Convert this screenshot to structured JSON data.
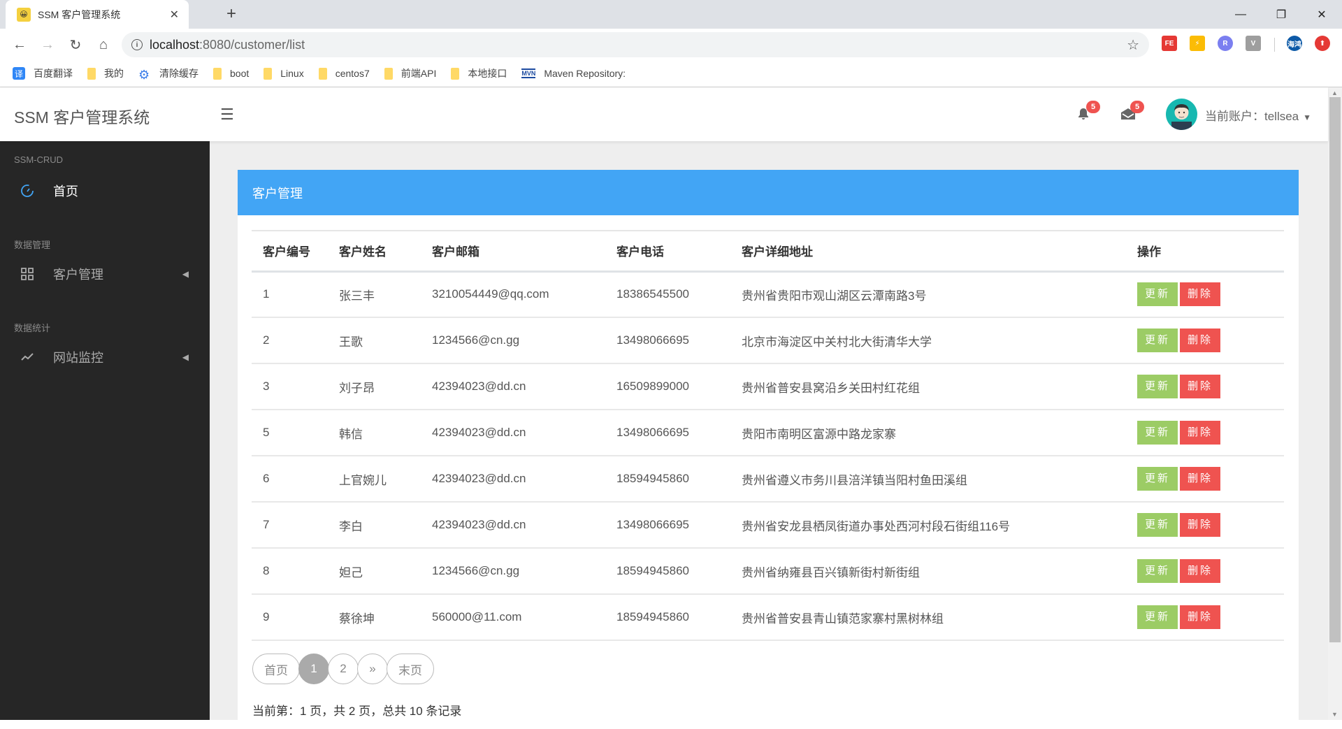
{
  "browser": {
    "tab_title": "SSM 客户管理系统",
    "url_host": "localhost",
    "url_path": ":8080/customer/list",
    "extensions": [
      {
        "name": "fe-helper",
        "label": "FE",
        "color": "#e53935"
      },
      {
        "name": "lightning-ext",
        "label": "⚡",
        "color": "#fbbc05"
      },
      {
        "name": "r-ext",
        "label": "R",
        "color": "#7b7ff0"
      },
      {
        "name": "vue-devtools",
        "label": "V",
        "color": "#9e9e9e"
      },
      {
        "name": "haihong-ext",
        "label": "海鸿",
        "color": "#0d5aa7"
      },
      {
        "name": "upload-ext",
        "label": "⬆",
        "color": "#e53935"
      }
    ],
    "bookmarks": [
      {
        "label": "百度翻译",
        "icon": "translate-icon"
      },
      {
        "label": "我的",
        "icon": "folder-icon"
      },
      {
        "label": "清除缓存",
        "icon": "gear-icon"
      },
      {
        "label": "boot",
        "icon": "folder-icon"
      },
      {
        "label": "Linux",
        "icon": "folder-icon"
      },
      {
        "label": "centos7",
        "icon": "folder-icon"
      },
      {
        "label": "前端API",
        "icon": "folder-icon"
      },
      {
        "label": "本地接口",
        "icon": "folder-icon"
      },
      {
        "label": "Maven Repository:",
        "icon": "mvn-icon"
      }
    ]
  },
  "header": {
    "brand": "SSM 客户管理系统",
    "notifications_count": "5",
    "messages_count": "5",
    "account_label": "当前账户：tellsea"
  },
  "sidebar": {
    "sections": [
      {
        "title": "SSM-CRUD",
        "items": [
          {
            "label": "首页",
            "icon": "dashboard-icon",
            "active": true
          }
        ]
      },
      {
        "title": "数据管理",
        "items": [
          {
            "label": "客户管理",
            "icon": "grid-icon",
            "active": false
          }
        ]
      },
      {
        "title": "数据统计",
        "items": [
          {
            "label": "网站监控",
            "icon": "line-chart-icon",
            "active": false
          }
        ]
      }
    ]
  },
  "panel": {
    "title": "客户管理",
    "columns": [
      "客户编号",
      "客户姓名",
      "客户邮箱",
      "客户电话",
      "客户详细地址",
      "操作"
    ],
    "update_label": "更新",
    "delete_label": "删除",
    "rows": [
      {
        "id": "1",
        "name": "张三丰",
        "email": "3210054449@qq.com",
        "phone": "18386545500",
        "address": "贵州省贵阳市观山湖区云潭南路3号"
      },
      {
        "id": "2",
        "name": "王歌",
        "email": "1234566@cn.gg",
        "phone": "13498066695",
        "address": "北京市海淀区中关村北大街清华大学"
      },
      {
        "id": "3",
        "name": "刘子昂",
        "email": "42394023@dd.cn",
        "phone": "16509899000",
        "address": "贵州省普安县窝沿乡关田村红花组"
      },
      {
        "id": "5",
        "name": "韩信",
        "email": "42394023@dd.cn",
        "phone": "13498066695",
        "address": "贵阳市南明区富源中路龙家寨"
      },
      {
        "id": "6",
        "name": "上官婉儿",
        "email": "42394023@dd.cn",
        "phone": "18594945860",
        "address": "贵州省遵义市务川县涪洋镇当阳村鱼田溪组"
      },
      {
        "id": "7",
        "name": "李白",
        "email": "42394023@dd.cn",
        "phone": "13498066695",
        "address": "贵州省安龙县栖凤街道办事处西河村段石街组116号"
      },
      {
        "id": "8",
        "name": "妲己",
        "email": "1234566@cn.gg",
        "phone": "18594945860",
        "address": "贵州省纳雍县百兴镇新街村新街组"
      },
      {
        "id": "9",
        "name": "蔡徐坤",
        "email": "560000@11.com",
        "phone": "18594945860",
        "address": "贵州省普安县青山镇范家寨村黑树林组"
      }
    ],
    "pagination": {
      "first": "首页",
      "pages": [
        "1",
        "2"
      ],
      "current": "1",
      "next": "»",
      "last": "末页"
    },
    "summary": "当前第：1 页，共 2 页，总共 10 条记录"
  },
  "colors": {
    "panel_header": "#42a5f5",
    "update_button": "#9ccc65",
    "delete_button": "#ef5350",
    "sidebar_bg": "#262626",
    "badge": "#ef5350"
  }
}
